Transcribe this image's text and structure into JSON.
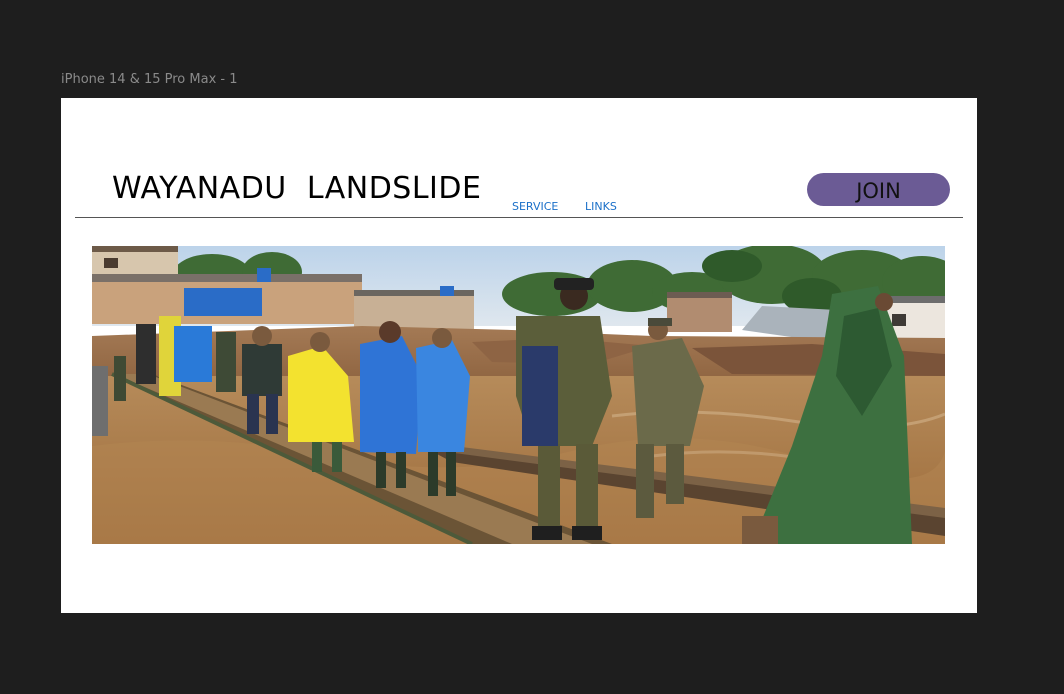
{
  "frame": {
    "label": "iPhone 14 & 15 Pro Max - 1"
  },
  "header": {
    "title": "WAYANADU  LANDSLIDE",
    "nav": {
      "service": "SERVICE",
      "links": "LINKS"
    },
    "join_label": "JOIN"
  },
  "colors": {
    "canvas_background": "#1e1e1e",
    "frame_background": "#ffffff",
    "join_button": "#6b5b95",
    "nav_link": "#1a6fc8"
  },
  "hero": {
    "icon": "photo-image"
  }
}
